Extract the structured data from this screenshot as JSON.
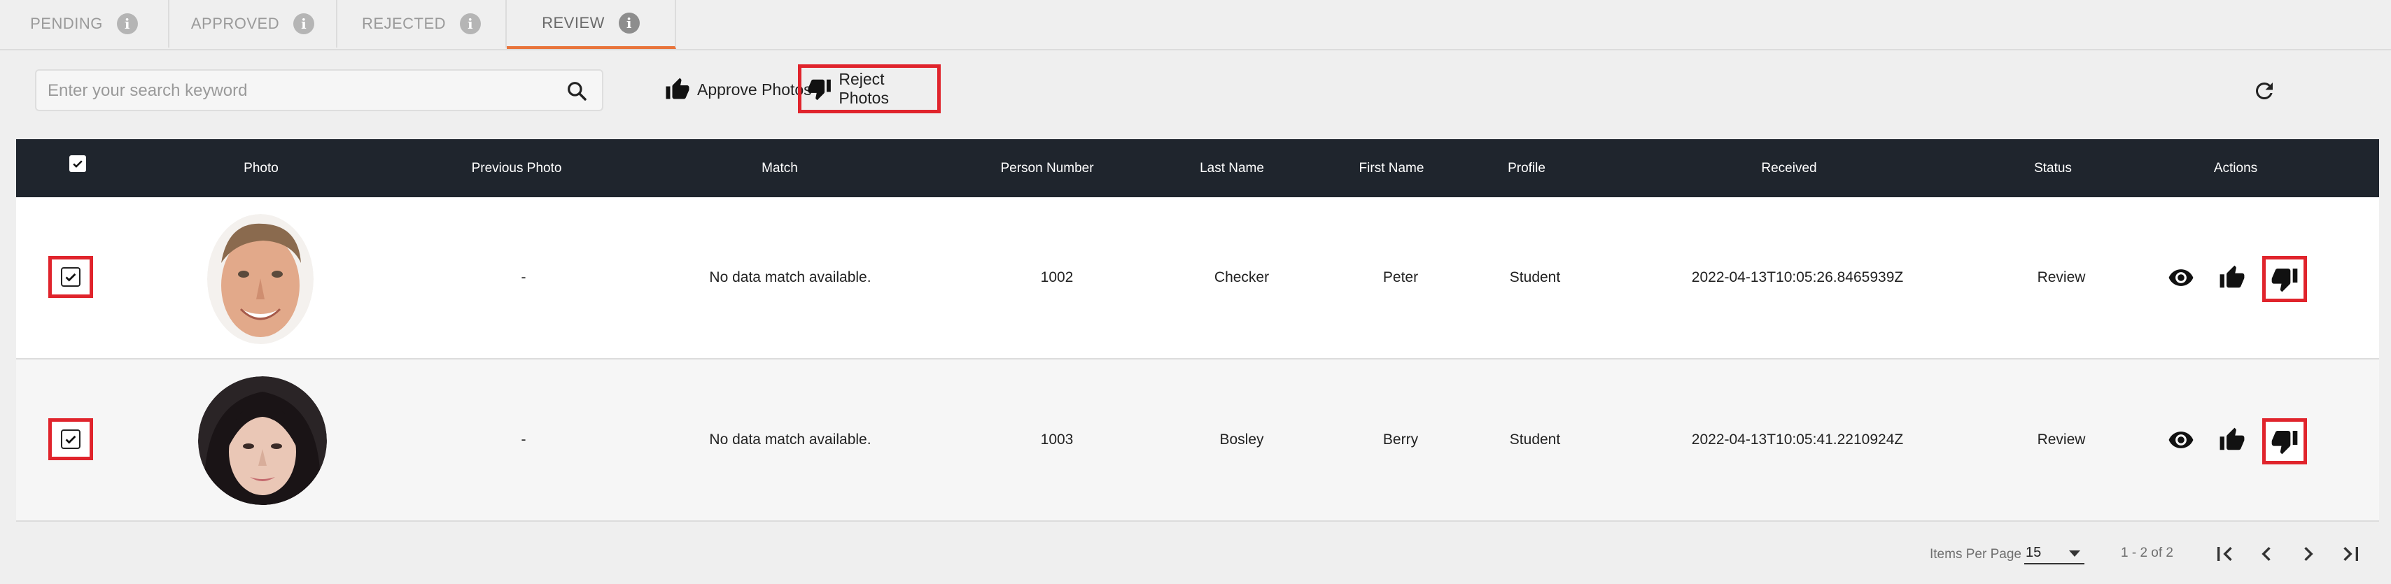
{
  "tabs": [
    {
      "label": "PENDING",
      "active": false
    },
    {
      "label": "APPROVED",
      "active": false
    },
    {
      "label": "REJECTED",
      "active": false
    },
    {
      "label": "REVIEW",
      "active": true
    }
  ],
  "tab_info_glyph": "i",
  "toolbar": {
    "search_placeholder": "Enter your search keyword",
    "search_value": "",
    "approve_label": "Approve Photos",
    "reject_label": "Reject Photos",
    "icons": {
      "search": "search-icon",
      "approve": "thumbs-up-icon",
      "reject": "thumbs-down-icon",
      "refresh": "refresh-icon"
    }
  },
  "table": {
    "headers": [
      "Photo",
      "Previous Photo",
      "Match",
      "Person Number",
      "Last Name",
      "First Name",
      "Profile",
      "Received",
      "Status",
      "Actions"
    ],
    "header_checkbox_checked": true,
    "rows": [
      {
        "checked": true,
        "photo": "male-portrait",
        "previous_photo": "-",
        "match": "No data match available.",
        "person_number": "1002",
        "last_name": "Checker",
        "first_name": "Peter",
        "profile": "Student",
        "received": "2022-04-13T10:05:26.8465939Z",
        "status": "Review"
      },
      {
        "checked": true,
        "photo": "female-portrait",
        "previous_photo": "-",
        "match": "No data match available.",
        "person_number": "1003",
        "last_name": "Bosley",
        "first_name": "Berry",
        "profile": "Student",
        "received": "2022-04-13T10:05:41.2210924Z",
        "status": "Review"
      }
    ],
    "row_actions": [
      "eye-icon",
      "thumbs-up-icon",
      "thumbs-down-icon"
    ]
  },
  "pagination": {
    "items_per_page_label": "Items Per Page",
    "items_per_page_value": "15",
    "range_label": "1 - 2 of 2",
    "icons": [
      "first-page-icon",
      "previous-page-icon",
      "next-page-icon",
      "last-page-icon"
    ]
  },
  "colors": {
    "accent": "#e8743b",
    "highlight": "#e0242c",
    "header_bg": "#1f252d"
  }
}
